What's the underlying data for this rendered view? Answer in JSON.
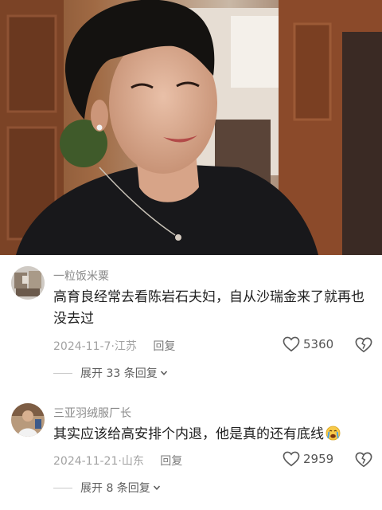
{
  "media": {
    "alt": "video-frame-woman-speaking"
  },
  "comments": [
    {
      "username": "一粒饭米粟",
      "text": "高育良经常去看陈岩石夫妇，自从沙瑞金来了就再也没去过",
      "date": "2024-11-7",
      "location": "江苏",
      "separator": "·",
      "reply_label": "回复",
      "likes": "5360",
      "expand_label": "展开 33 条回复"
    },
    {
      "username": "三亚羽绒服厂长",
      "text": "其实应该给高安排个内退，他是真的还有底线",
      "emoji": "crying-face",
      "date": "2024-11-21",
      "location": "山东",
      "separator": "·",
      "reply_label": "回复",
      "likes": "2959",
      "expand_label": "展开 8 条回复"
    }
  ],
  "colors": {
    "text": "#202020",
    "meta": "#a2a2a2",
    "username": "#8a8a8a"
  }
}
